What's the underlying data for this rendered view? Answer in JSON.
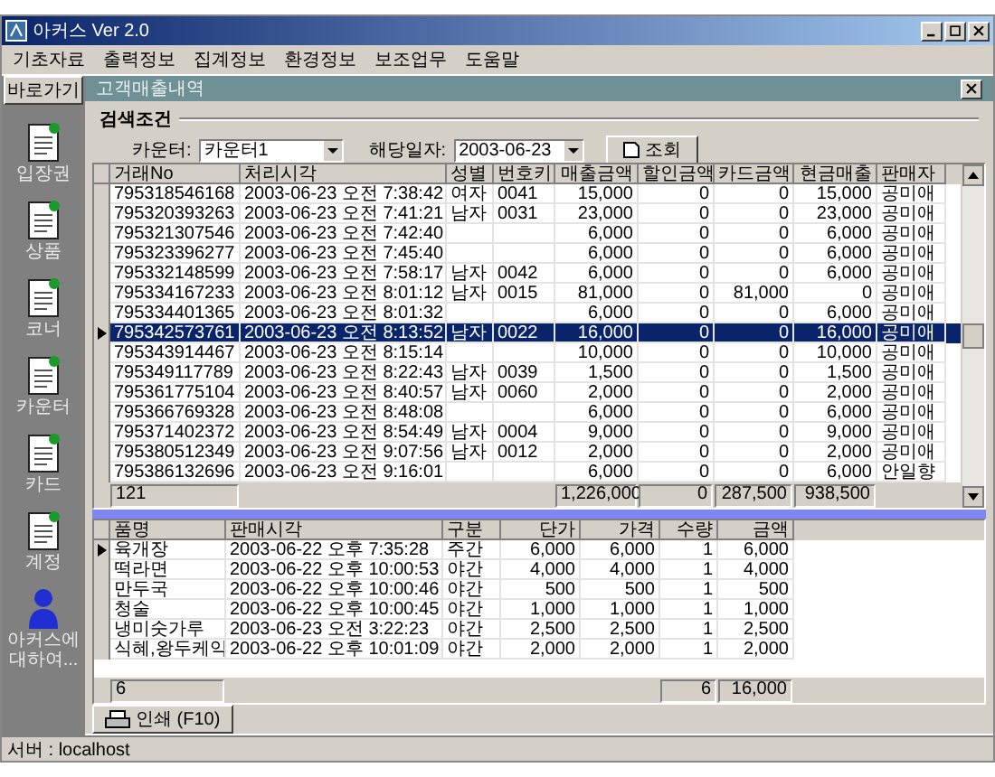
{
  "window": {
    "title": "아커스 Ver 2.0"
  },
  "menu": [
    {
      "label": "기초자료"
    },
    {
      "label": "출력정보"
    },
    {
      "label": "집계정보"
    },
    {
      "label": "환경정보"
    },
    {
      "label": "보조업무"
    },
    {
      "label": "도움말"
    }
  ],
  "shortcut_button": "바로가기",
  "sidebar": {
    "items": [
      {
        "label": "입장권",
        "kind": "document"
      },
      {
        "label": "상품",
        "kind": "document"
      },
      {
        "label": "코너",
        "kind": "document"
      },
      {
        "label": "카운터",
        "kind": "document"
      },
      {
        "label": "카드",
        "kind": "document"
      },
      {
        "label": "계정",
        "kind": "document"
      },
      {
        "label": "아커스에 대하여...",
        "kind": "person"
      }
    ]
  },
  "panel": {
    "title": "고객매출내역"
  },
  "search": {
    "title": "검색조건",
    "counter_label": "카운터:",
    "counter_value": "카운터1",
    "date_label": "해당일자:",
    "date_value": "2003-06-23",
    "button": "조회"
  },
  "sales_table": {
    "columns": [
      {
        "label": "거래No",
        "total": "121"
      },
      {
        "label": "처리시각"
      },
      {
        "label": "성별"
      },
      {
        "label": "번호키"
      },
      {
        "label": "매출금액",
        "total": "1,226,000"
      },
      {
        "label": "할인금액",
        "total": "0"
      },
      {
        "label": "카드금액",
        "total": "287,500"
      },
      {
        "label": "현금매출",
        "total": "938,500"
      },
      {
        "label": "판매자"
      }
    ],
    "rows": [
      {
        "selected": false,
        "no": "795318546168",
        "time": "2003-06-23 오전 7:38:42",
        "gender": "여자",
        "key": "0041",
        "sales": "15,000",
        "discount": "0",
        "card": "0",
        "cash": "15,000",
        "seller": "공미애"
      },
      {
        "selected": false,
        "no": "795320393263",
        "time": "2003-06-23 오전 7:41:21",
        "gender": "남자",
        "key": "0031",
        "sales": "23,000",
        "discount": "0",
        "card": "0",
        "cash": "23,000",
        "seller": "공미애"
      },
      {
        "selected": false,
        "no": "795321307546",
        "time": "2003-06-23 오전 7:42:40",
        "sales": "6,000",
        "discount": "0",
        "card": "0",
        "cash": "6,000",
        "seller": "공미애"
      },
      {
        "selected": false,
        "no": "795323396277",
        "time": "2003-06-23 오전 7:45:40",
        "sales": "6,000",
        "discount": "0",
        "card": "0",
        "cash": "6,000",
        "seller": "공미애"
      },
      {
        "selected": false,
        "no": "795332148599",
        "time": "2003-06-23 오전 7:58:17",
        "gender": "남자",
        "key": "0042",
        "sales": "6,000",
        "discount": "0",
        "card": "0",
        "cash": "6,000",
        "seller": "공미애"
      },
      {
        "selected": false,
        "no": "795334167233",
        "time": "2003-06-23 오전 8:01:12",
        "gender": "남자",
        "key": "0015",
        "sales": "81,000",
        "discount": "0",
        "card": "81,000",
        "cash": "0",
        "seller": "공미애"
      },
      {
        "selected": false,
        "no": "795334401365",
        "time": "2003-06-23 오전 8:01:32",
        "sales": "6,000",
        "discount": "0",
        "card": "0",
        "cash": "6,000",
        "seller": "공미애"
      },
      {
        "selected": true,
        "no": "795342573761",
        "time": "2003-06-23 오전 8:13:52",
        "gender": "남자",
        "key": "0022",
        "sales": "16,000",
        "discount": "0",
        "card": "0",
        "cash": "16,000",
        "seller": "공미애"
      },
      {
        "selected": false,
        "no": "795343914467",
        "time": "2003-06-23 오전 8:15:14",
        "sales": "10,000",
        "discount": "0",
        "card": "0",
        "cash": "10,000",
        "seller": "공미애"
      },
      {
        "selected": false,
        "no": "795349117789",
        "time": "2003-06-23 오전 8:22:43",
        "gender": "남자",
        "key": "0039",
        "sales": "1,500",
        "discount": "0",
        "card": "0",
        "cash": "1,500",
        "seller": "공미애"
      },
      {
        "selected": false,
        "no": "795361775104",
        "time": "2003-06-23 오전 8:40:57",
        "gender": "남자",
        "key": "0060",
        "sales": "2,000",
        "discount": "0",
        "card": "0",
        "cash": "2,000",
        "seller": "공미애"
      },
      {
        "selected": false,
        "no": "795366769328",
        "time": "2003-06-23 오전 8:48:08",
        "sales": "6,000",
        "discount": "0",
        "card": "0",
        "cash": "6,000",
        "seller": "공미애"
      },
      {
        "selected": false,
        "no": "795371402372",
        "time": "2003-06-23 오전 8:54:49",
        "gender": "남자",
        "key": "0004",
        "sales": "9,000",
        "discount": "0",
        "card": "0",
        "cash": "9,000",
        "seller": "공미애"
      },
      {
        "selected": false,
        "no": "795380512349",
        "time": "2003-06-23 오전 9:07:56",
        "gender": "남자",
        "key": "0012",
        "sales": "2,000",
        "discount": "0",
        "card": "0",
        "cash": "2,000",
        "seller": "공미애"
      },
      {
        "selected": false,
        "no": "795386132696",
        "time": "2003-06-23 오전 9:16:01",
        "sales": "6,000",
        "discount": "0",
        "card": "0",
        "cash": "6,000",
        "seller": "안일향"
      }
    ]
  },
  "items_table": {
    "columns": [
      {
        "label": "품명",
        "total": "6"
      },
      {
        "label": "판매시각"
      },
      {
        "label": "구분"
      },
      {
        "label": "단가"
      },
      {
        "label": "가격"
      },
      {
        "label": "수량",
        "total": "6"
      },
      {
        "label": "금액",
        "total": "16,000"
      }
    ],
    "rows": [
      {
        "current": true,
        "item": "육개장",
        "time": "2003-06-22 오후 7:35:28",
        "period": "주간",
        "unit": "6,000",
        "price": "6,000",
        "qty": "1",
        "amount": "6,000"
      },
      {
        "current": false,
        "item": "떡라면",
        "time": "2003-06-22 오후 10:00:53",
        "period": "야간",
        "unit": "4,000",
        "price": "4,000",
        "qty": "1",
        "amount": "4,000"
      },
      {
        "current": false,
        "item": "만두국",
        "time": "2003-06-22 오후 10:00:46",
        "period": "야간",
        "unit": "500",
        "price": "500",
        "qty": "1",
        "amount": "500"
      },
      {
        "current": false,
        "item": "청술",
        "time": "2003-06-22 오후 10:00:45",
        "period": "야간",
        "unit": "1,000",
        "price": "1,000",
        "qty": "1",
        "amount": "1,000"
      },
      {
        "current": false,
        "item": "냉미숫가루",
        "time": "2003-06-23 오전 3:22:23",
        "period": "야간",
        "unit": "2,500",
        "price": "2,500",
        "qty": "1",
        "amount": "2,500"
      },
      {
        "current": false,
        "item": "식혜,왕두케익",
        "time": "2003-06-22 오후 10:01:09",
        "period": "야간",
        "unit": "2,000",
        "price": "2,000",
        "qty": "1",
        "amount": "2,000"
      }
    ]
  },
  "print_button": "인쇄 (F10)",
  "status_bar": "서버 : localhost"
}
